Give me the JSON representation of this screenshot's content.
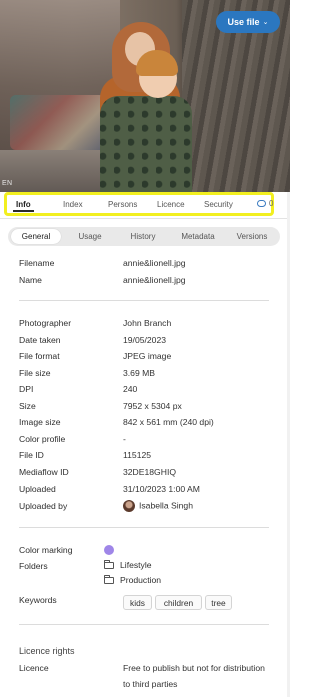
{
  "photo": {
    "language_tag": "EN",
    "use_file_label": "Use file"
  },
  "tabs": {
    "items": [
      {
        "label": "Info",
        "active": true
      },
      {
        "label": "Index"
      },
      {
        "label": "Persons"
      },
      {
        "label": "Licence"
      },
      {
        "label": "Security"
      }
    ],
    "comment_count": "0"
  },
  "subtabs": {
    "items": [
      {
        "label": "General",
        "active": true
      },
      {
        "label": "Usage"
      },
      {
        "label": "History"
      },
      {
        "label": "Metadata"
      },
      {
        "label": "Versions"
      }
    ]
  },
  "fields": {
    "filename": {
      "label": "Filename",
      "value": "annie&lionell.jpg"
    },
    "name": {
      "label": "Name",
      "value": "annie&lionell.jpg"
    },
    "photographer": {
      "label": "Photographer",
      "value": "John Branch"
    },
    "date_taken": {
      "label": "Date taken",
      "value": "19/05/2023"
    },
    "file_format": {
      "label": "File format",
      "value": "JPEG image"
    },
    "file_size": {
      "label": "File size",
      "value": "3.69 MB"
    },
    "dpi": {
      "label": "DPI",
      "value": "240"
    },
    "size": {
      "label": "Size",
      "value": "7952 x 5304 px"
    },
    "image_size": {
      "label": "Image size",
      "value": "842 x 561 mm (240 dpi)"
    },
    "color_profile": {
      "label": "Color profile",
      "value": "-"
    },
    "file_id": {
      "label": "File ID",
      "value": "115125"
    },
    "mediaflow_id": {
      "label": "Mediaflow ID",
      "value": "32DE18GHIQ"
    },
    "uploaded": {
      "label": "Uploaded",
      "value": "31/10/2023 1:00 AM"
    },
    "uploaded_by": {
      "label": "Uploaded by",
      "value": "Isabella Singh"
    }
  },
  "classification": {
    "color_marking_label": "Color marking",
    "color_marking_color": "#9f86e8",
    "folders_label": "Folders",
    "folders": [
      "Lifestyle",
      "Production"
    ],
    "keywords_label": "Keywords",
    "keywords": [
      "kids",
      "children",
      "tree"
    ]
  },
  "licence": {
    "section_title": "Licence rights",
    "label": "Licence",
    "value": "Free to publish but not for distribution to third parties"
  },
  "colors": {
    "accent": "#2b77c0",
    "highlight": "#f2ef1f"
  }
}
